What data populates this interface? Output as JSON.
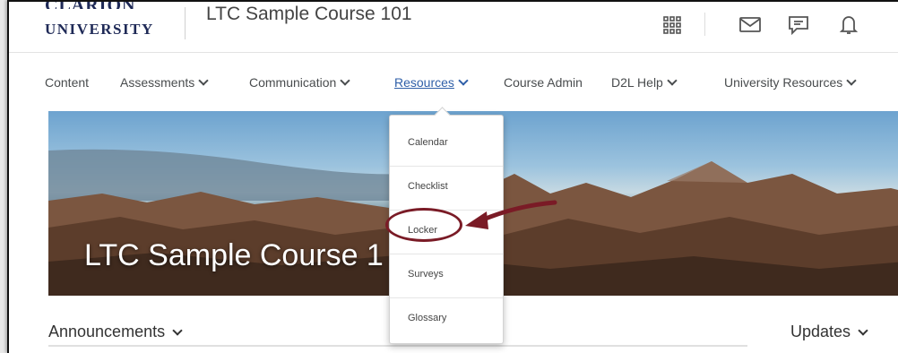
{
  "header": {
    "logo_top": "CLARION",
    "logo_bottom": "UNIVERSITY",
    "course_title": "LTC Sample Course 101"
  },
  "nav": {
    "items": [
      {
        "label": "Content",
        "has_menu": false
      },
      {
        "label": "Assessments",
        "has_menu": true
      },
      {
        "label": "Communication",
        "has_menu": true
      },
      {
        "label": "Resources",
        "has_menu": true,
        "active": true
      },
      {
        "label": "Course Admin",
        "has_menu": false
      },
      {
        "label": "D2L Help",
        "has_menu": true
      },
      {
        "label": "University Resources",
        "has_menu": true
      }
    ]
  },
  "banner": {
    "title": "LTC Sample Course 1"
  },
  "dropdown": {
    "items": [
      "Calendar",
      "Checklist",
      "Locker",
      "Surveys",
      "Glossary"
    ],
    "highlighted": "Locker"
  },
  "widgets": {
    "announcements": "Announcements",
    "updates": "Updates"
  },
  "colors": {
    "logo": "#1f2a57",
    "active_link": "#2f5fa8",
    "annotation": "#7a1b26"
  }
}
